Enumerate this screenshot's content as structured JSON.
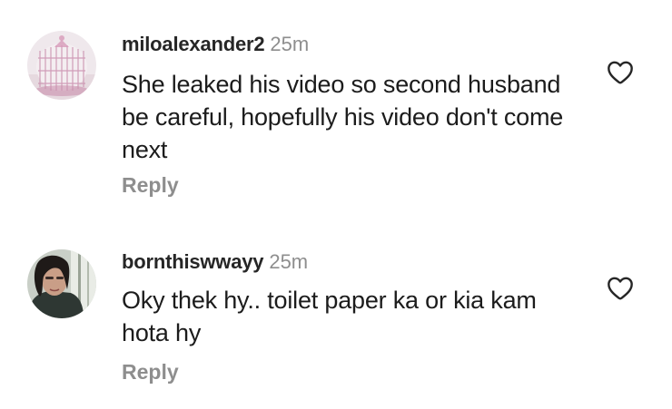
{
  "comments": [
    {
      "username": "miloalexander2",
      "timestamp": "25m",
      "text": "She leaked his video so second husband be careful, hopefully his video don't come next",
      "reply_label": "Reply",
      "avatar_icon": "avatar-photo-birdcage",
      "like_icon": "heart-outline-icon"
    },
    {
      "username": "bornthiswwayy",
      "timestamp": "25m",
      "text": "Oky thek hy.. toilet paper ka or kia kam hota hy",
      "reply_label": "Reply",
      "avatar_icon": "avatar-photo-portrait",
      "like_icon": "heart-outline-icon"
    }
  ],
  "colors": {
    "username": "#262626",
    "text": "#1c1c1c",
    "muted": "#8e8e8e",
    "icon": "#262626"
  }
}
